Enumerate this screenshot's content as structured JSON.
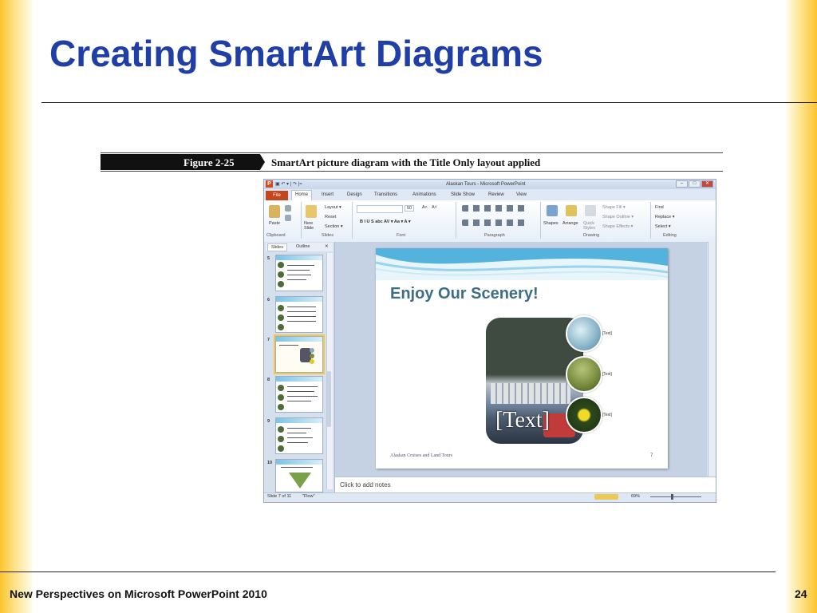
{
  "slide": {
    "title": "Creating SmartArt Diagrams",
    "footer": "New Perspectives on Microsoft PowerPoint 2010",
    "page_number": "24"
  },
  "figure": {
    "label": "Figure 2-25",
    "caption": "SmartArt picture diagram with the Title Only layout applied"
  },
  "ppt": {
    "window_title": "Alaskan Tours - Microsoft PowerPoint",
    "qat": "▣ ↶ ▾ | ↷ |=",
    "window_buttons": [
      "–",
      "□",
      "✕"
    ],
    "tabs": {
      "file": "File",
      "items": [
        "Home",
        "Insert",
        "Design",
        "Transitions",
        "Animations",
        "Slide Show",
        "Review",
        "View"
      ]
    },
    "ribbon": {
      "clipboard": {
        "paste": "Paste",
        "label": "Clipboard"
      },
      "slides": {
        "new_slide": "New Slide",
        "layout": "Layout ▾",
        "reset": "Reset",
        "section": "Section ▾",
        "label": "Slides"
      },
      "font": {
        "size": "50",
        "grow": "A˄",
        "shrink": "A˅",
        "format_buttons": "B  I  U  S  abc  AV ▾  Aa ▾  A ▾",
        "label": "Font"
      },
      "paragraph": {
        "label": "Paragraph"
      },
      "drawing": {
        "shapes": "Shapes",
        "arrange": "Arrange",
        "quick_styles": "Quick Styles",
        "shape_fill": "Shape Fill ▾",
        "shape_outline": "Shape Outline ▾",
        "shape_effects": "Shape Effects ▾",
        "label": "Drawing"
      },
      "editing": {
        "find": "Find",
        "replace": "Replace ▾",
        "select": "Select ▾",
        "label": "Editing"
      }
    },
    "pane": {
      "tabs": [
        "Slides",
        "Outline"
      ],
      "close": "✕",
      "thumbs": [
        {
          "num": "5",
          "title": ""
        },
        {
          "num": "6",
          "title": ""
        },
        {
          "num": "7",
          "title": ""
        },
        {
          "num": "8",
          "title": ""
        },
        {
          "num": "9",
          "title": ""
        },
        {
          "num": "10",
          "title": ""
        }
      ],
      "selected_index": 2
    },
    "editing_slide": {
      "title": "Enjoy Our Scenery!",
      "photo_text": "[Text]",
      "circle_texts": [
        "[Text]",
        "[Text]",
        "[Text]"
      ],
      "footer": "Alaskan Cruises and Land Tours",
      "number": "7"
    },
    "notes_placeholder": "Click to add notes",
    "status": {
      "slide_info": "Slide 7 of 11",
      "theme": "\"Flow\"",
      "zoom": "69%"
    }
  },
  "colors": {
    "title_blue": "#1f3fa6",
    "side_bar_gold": "#fbc52c",
    "file_tab": "#c4451e"
  }
}
